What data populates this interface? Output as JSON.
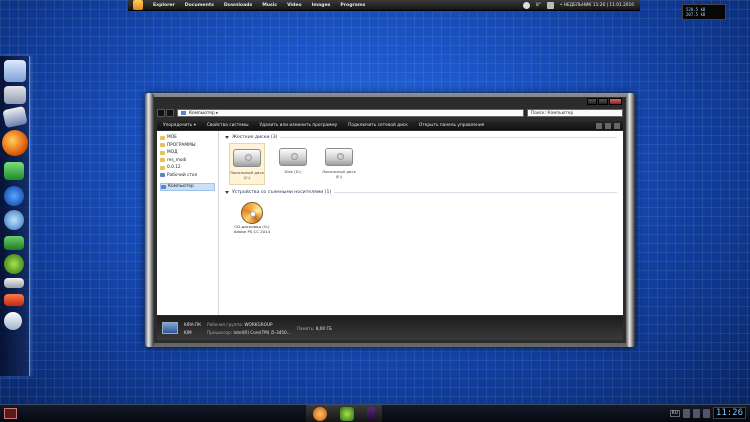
{
  "menubar": {
    "items": [
      "Explorer",
      "Documents",
      "Downloads",
      "Music",
      "Video",
      "Images",
      "Programs"
    ],
    "temperature": "8°",
    "datetime": "• НЕДЕЛЬНИК 11:26 | 11.01.2016"
  },
  "clock_widget": {
    "line1": "520.5 kB",
    "line2": "207.5 kB"
  },
  "explorer": {
    "address": "Компьютер ▸",
    "search_placeholder": "Поиск: Компьютер",
    "toolbar": [
      "Упорядочить ▾",
      "Свойства системы",
      "Удалить или изменить программу",
      "Подключить сетевой диск",
      "Открыть панель управления"
    ],
    "nav_items": [
      "МОЕ",
      "ПРОГРАММЫ",
      "МОД",
      "res_modi",
      "0.0.12",
      "Рабочий стол",
      "Компьютер"
    ],
    "hdd_group": "Жесткие диски (3)",
    "drives": [
      {
        "label": "Локальный диск (C:)"
      },
      {
        "label": "Disk (D:)"
      },
      {
        "label": "Локальный диск (E:)"
      }
    ],
    "removable_group": "Устройства со съемными носителями (1)",
    "cd": {
      "line1": "CD-дисковод (G:)",
      "line2": "Adobe PS CC 2014"
    },
    "details": {
      "name": "KIRA-ПК",
      "sub": "KIM",
      "workgroup_label": "Рабочая группа:",
      "workgroup": "WORKGROUP",
      "memory_label": "Память:",
      "memory": "8,00 ГБ",
      "cpu_label": "Процессор:",
      "cpu": "Intel(R) Core(TM) i5-3450..."
    }
  },
  "taskbar": {
    "lang": "RU",
    "time": "11:26"
  }
}
